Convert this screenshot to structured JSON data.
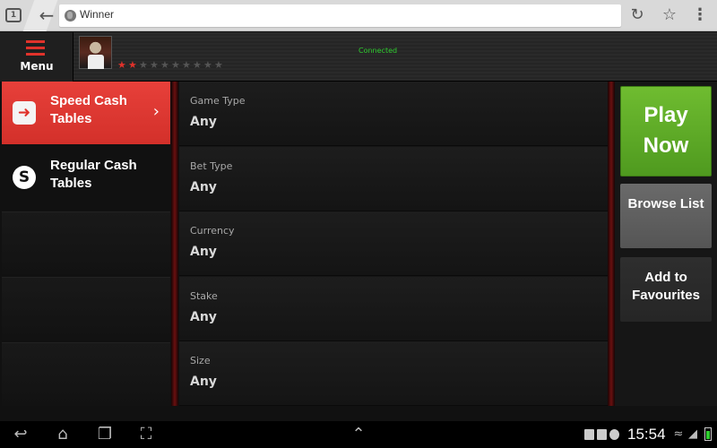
{
  "browser": {
    "tab_count": "1",
    "page_title": "Winner"
  },
  "app_header": {
    "menu_label": "Menu",
    "status": "Connected",
    "rating": {
      "filled": 2,
      "total": 10
    }
  },
  "categories": [
    {
      "label": "Speed Cash Tables",
      "icon": "speed-icon",
      "active": true
    },
    {
      "label": "Regular Cash Tables",
      "icon": "regular-icon",
      "active": false
    }
  ],
  "filters": [
    {
      "label": "Game Type",
      "value": "Any"
    },
    {
      "label": "Bet Type",
      "value": "Any"
    },
    {
      "label": "Currency",
      "value": "Any"
    },
    {
      "label": "Stake",
      "value": "Any"
    },
    {
      "label": "Size",
      "value": "Any"
    }
  ],
  "actions": {
    "play_now": "Play Now",
    "browse_list": "Browse List",
    "add_to_favourites": "Add to Favourites"
  },
  "system_bar": {
    "time": "15:54"
  },
  "colors": {
    "accent_red": "#e0322b",
    "play_green": "#5aa624",
    "connected_green": "#2fcc2f"
  }
}
